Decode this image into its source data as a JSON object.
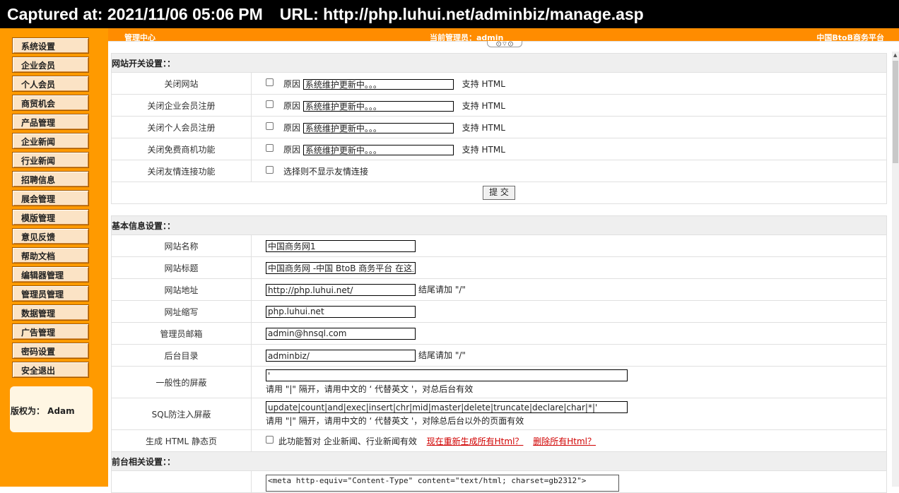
{
  "capture": {
    "captured_at": "Captured at: 2021/11/06 05:06 PM",
    "url": "URL: http://php.luhui.net/adminbiz/manage.asp"
  },
  "topbar": {
    "left": "管理中心",
    "center": "当前管理员：admin",
    "right": "中国BtoB商务平台"
  },
  "sidebar": {
    "items": [
      {
        "label": "系统设置"
      },
      {
        "label": "企业会员"
      },
      {
        "label": "个人会员"
      },
      {
        "label": "商贸机会"
      },
      {
        "label": "产品管理"
      },
      {
        "label": "企业新闻"
      },
      {
        "label": "行业新闻"
      },
      {
        "label": "招聘信息"
      },
      {
        "label": "展会管理"
      },
      {
        "label": "模版管理"
      },
      {
        "label": "意见反馈"
      },
      {
        "label": "帮助文档"
      },
      {
        "label": "编辑器管理"
      },
      {
        "label": "管理员管理"
      },
      {
        "label": "数据管理"
      },
      {
        "label": "广告管理"
      },
      {
        "label": "密码设置"
      },
      {
        "label": "安全退出"
      }
    ],
    "copyright": "版权为： Adam"
  },
  "switch_section": {
    "title": "网站开关设置：：",
    "reason_label": "原因",
    "html_note": "支持 HTML",
    "rows": [
      {
        "label": "关闭网站",
        "reason": "系统维护更新中。。。"
      },
      {
        "label": "关闭企业会员注册",
        "reason": "系统维护更新中。。。"
      },
      {
        "label": "关闭个人会员注册",
        "reason": "系统维护更新中。。。"
      },
      {
        "label": "关闭免费商机功能",
        "reason": "系统维护更新中。。。"
      }
    ],
    "links_row": {
      "label": "关闭友情连接功能",
      "note": "选择则不显示友情连接"
    },
    "submit": "提 交"
  },
  "basic_section": {
    "title": "基本信息设置：：",
    "site_name": {
      "label": "网站名称",
      "value": "中国商务网1"
    },
    "site_title": {
      "label": "网站标题",
      "value": "中国商务网 -中国 BtoB 商务平台 在这里"
    },
    "site_url": {
      "label": "网站地址",
      "value": "http://php.luhui.net/",
      "hint": "结尾请加 \"/\""
    },
    "site_short": {
      "label": "网址缩写",
      "value": "php.luhui.net"
    },
    "admin_email": {
      "label": "管理员邮箱",
      "value": "admin@hnsql.com"
    },
    "admin_dir": {
      "label": "后台目录",
      "value": "adminbiz/",
      "hint": "结尾请加 \"/\""
    },
    "general_filter": {
      "label": "一般性的屏蔽",
      "value": "'",
      "hint": "请用 \"|\" 隔开，请用中文的 ‘ 代替英文 '，对总后台有效"
    },
    "sql_filter": {
      "label": "SQL防注入屏蔽",
      "value": "update|count|and|exec|insert|chr|mid|master|delete|truncate|declare|char|*|'",
      "hint": "请用 \"|\" 隔开，请用中文的 ‘ 代替英文 '，对除总后台以外的页面有效"
    },
    "html_static": {
      "label": "生成 HTML 静态页",
      "note": "此功能暂对 企业新闻、行业新闻有效",
      "regen_link": "现在重新生成所有Html？",
      "delete_link": "删除所有Html？"
    }
  },
  "front_section": {
    "title": "前台相关设置：：",
    "meta_value": "<meta http-equiv=\"Content-Type\" content=\"text/html; charset=gb2312\">"
  }
}
